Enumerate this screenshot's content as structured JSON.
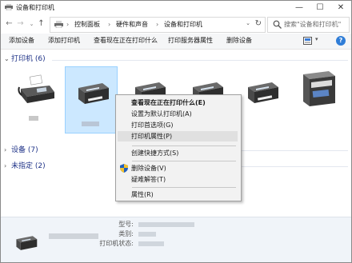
{
  "window": {
    "title": "设备和打印机",
    "controls": {
      "minimize": "—",
      "maximize": "☐",
      "close": "✕"
    }
  },
  "nav": {
    "back": "←",
    "forward": "→",
    "recent": "⌄",
    "up": "↑"
  },
  "address": {
    "chevron": "›",
    "crumbs": [
      "控制面板",
      "硬件和声音",
      "设备和打印机"
    ],
    "dropdown": "⌄",
    "refresh": "↻"
  },
  "search": {
    "placeholder": "搜索\"设备和打印机\""
  },
  "commands": [
    "添加设备",
    "添加打印机",
    "查看现在正在打印什么",
    "打印服务器属性",
    "删除设备"
  ],
  "toolbar": {
    "view_dropdown": "▾",
    "help": "?"
  },
  "groups": {
    "printers": {
      "chevron": "⌄",
      "label": "打印机 (6)"
    },
    "devices": {
      "chevron": "›",
      "label": "设备 (7)"
    },
    "unspecified": {
      "chevron": "›",
      "label": "未指定 (2)"
    }
  },
  "printers": [
    {
      "icon": "fax-icon",
      "selected": false
    },
    {
      "icon": "printer-icon",
      "selected": true
    },
    {
      "icon": "printer-icon",
      "selected": false
    },
    {
      "icon": "printer-icon",
      "selected": false
    },
    {
      "icon": "printer-icon",
      "selected": false
    },
    {
      "icon": "multifunction-printer-icon",
      "selected": false
    }
  ],
  "context_menu": {
    "items": [
      {
        "label": "查看现在正在打印什么(E)",
        "bold": true
      },
      {
        "label": "设置为默认打印机(A)"
      },
      {
        "label": "打印首选项(G)"
      },
      {
        "label": "打印机属性(P)",
        "highlighted": true
      },
      {
        "label": "创建快捷方式(S)"
      },
      {
        "label": "删除设备(V)",
        "icon": "shield-icon"
      },
      {
        "label": "疑难解答(T)"
      },
      {
        "label": "属性(R)"
      }
    ]
  },
  "details": {
    "model_label": "型号:",
    "category_label": "类别:",
    "status_label": "打印机状态:"
  },
  "colors": {
    "accent": "#1e3287",
    "selection": "#cce8ff",
    "menu_bg": "#f2f2f2"
  }
}
